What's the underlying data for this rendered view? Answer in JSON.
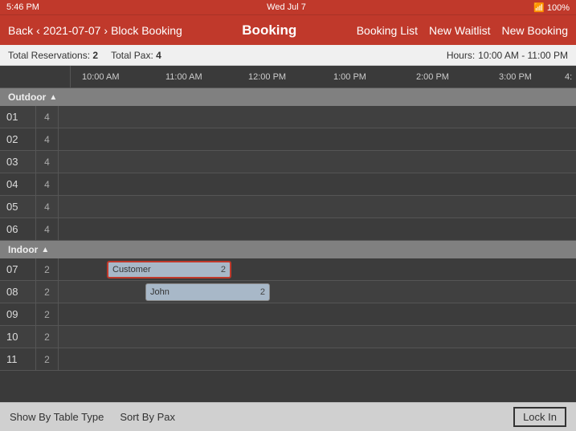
{
  "statusBar": {
    "time": "5:46 PM",
    "day": "Wed Jul 7",
    "wifi": "WiFi",
    "battery": "100%"
  },
  "navBar": {
    "back": "Back",
    "date": "2021-07-07",
    "blockBooking": "Block Booking",
    "title": "Booking",
    "bookingList": "Booking List",
    "newWaitlist": "New Waitlist",
    "newBooking": "New Booking"
  },
  "infoBar": {
    "totalReservationsLabel": "Total Reservations:",
    "totalReservationsValue": "2",
    "totalPaxLabel": "Total Pax:",
    "totalPaxValue": "4",
    "hoursLabel": "Hours:",
    "hoursValue": "10:00 AM - 11:00 PM"
  },
  "timeline": {
    "times": [
      "10:00 AM",
      "11:00 AM",
      "12:00 PM",
      "1:00 PM",
      "2:00 PM",
      "3:00 PM",
      "4:"
    ]
  },
  "sections": [
    {
      "name": "Outdoor",
      "tables": [
        {
          "id": "01",
          "pax": 4
        },
        {
          "id": "02",
          "pax": 4
        },
        {
          "id": "03",
          "pax": 4
        },
        {
          "id": "04",
          "pax": 4
        },
        {
          "id": "05",
          "pax": 4
        },
        {
          "id": "06",
          "pax": 4
        }
      ]
    },
    {
      "name": "Indoor",
      "tables": [
        {
          "id": "07",
          "pax": 2,
          "booking": {
            "name": "Customer",
            "pax": 2,
            "type": "customer"
          }
        },
        {
          "id": "08",
          "pax": 2,
          "booking": {
            "name": "John",
            "pax": 2,
            "type": "john"
          }
        },
        {
          "id": "09",
          "pax": 2
        },
        {
          "id": "10",
          "pax": 2
        },
        {
          "id": "11",
          "pax": 2
        }
      ]
    }
  ],
  "bottomBar": {
    "showByTableType": "Show By Table Type",
    "sortByPax": "Sort By Pax",
    "lockIn": "Lock In"
  }
}
